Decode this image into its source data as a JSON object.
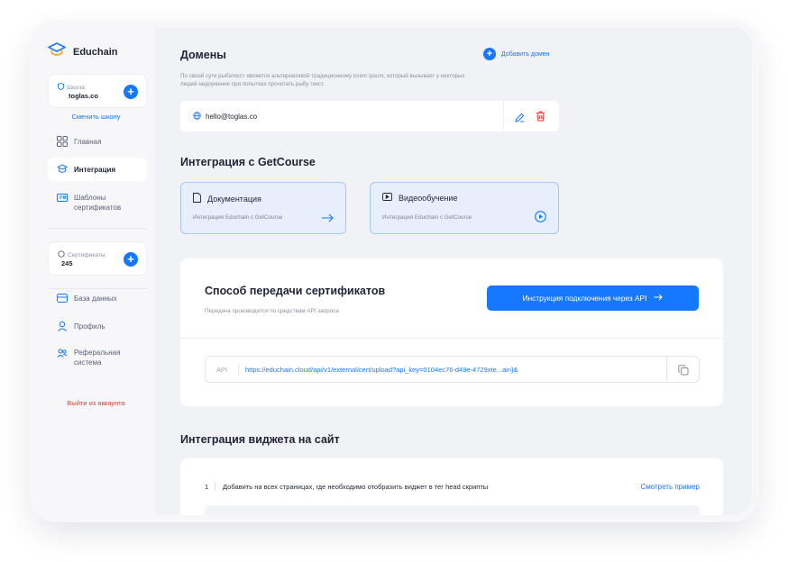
{
  "brand": {
    "name": "Educhain",
    "accent": "#1677ff",
    "danger": "#e53935"
  },
  "sidebar": {
    "school": {
      "label": "Школа:",
      "value": "toglas.co"
    },
    "change_school": "Сменить школу",
    "nav": [
      {
        "label": "Главная",
        "icon": "grid-icon"
      },
      {
        "label": "Интеграция",
        "icon": "integration-icon",
        "active": true
      },
      {
        "label": "Шаблоны сертификатов",
        "icon": "template-icon"
      }
    ],
    "certs": {
      "label": "Сертификаты:",
      "value": "245"
    },
    "nav2": [
      {
        "label": "База данных",
        "icon": "database-icon"
      },
      {
        "label": "Профиль",
        "icon": "user-icon"
      },
      {
        "label": "Реферальная система",
        "icon": "referral-icon"
      }
    ],
    "logout": "Выйти из аккаунта"
  },
  "domains": {
    "title": "Домены",
    "add_label": "Добавить домен",
    "description": "По своей сути рыбатекст является альтернативой традиционному lorem ipsum, который вызывает у некторых людей недоумение при попытках прочитать рыбу текст.",
    "items": [
      "hello@toglas.co"
    ]
  },
  "integration": {
    "title": "Интеграция с GetCourse",
    "tiles": [
      {
        "title": "Документация",
        "subtitle": "Интеграция Educhain с GetCourse"
      },
      {
        "title": "Видеообучение",
        "subtitle": "Интеграция Educhain с GetCourse"
      }
    ]
  },
  "transfer": {
    "title": "Способ передачи сертификатов",
    "subtitle": "Передача производится по средствам API запроса",
    "button": "Инструкция подключения через API",
    "api_label": "API",
    "api_url": "https://educhain.cloud/api/v1/external/cert/upload?api_key=0104ec76-d49e-4729xte...ain}&"
  },
  "widget": {
    "title": "Интеграция виджета на сайт",
    "steps": [
      {
        "num": "1",
        "text": "Добавить на всех страницах, где необходимо отобразить виджет в тег head скрипты",
        "link": "Смотреть пример"
      }
    ]
  }
}
